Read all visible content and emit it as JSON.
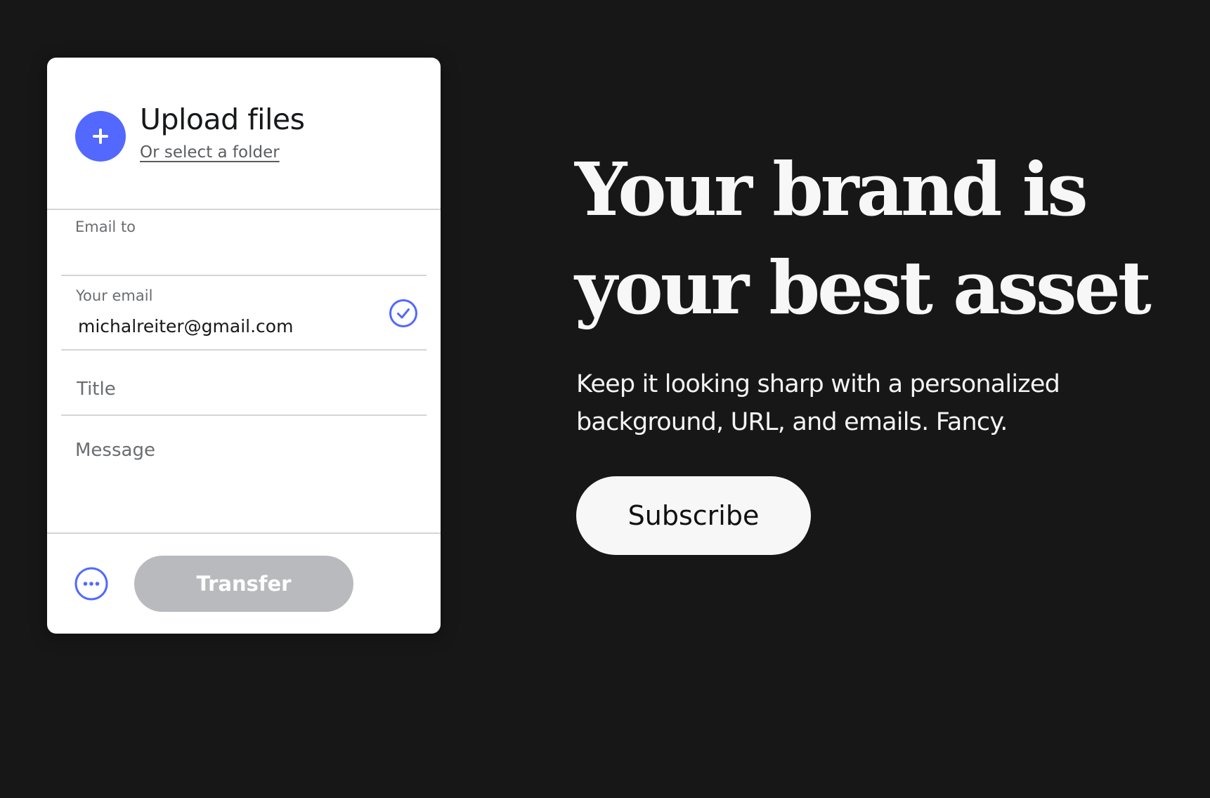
{
  "colors": {
    "page_background": "#171717",
    "accent": "#5268ff",
    "card_background": "#ffffff",
    "transfer_disabled": "#b9babd",
    "subscribe_background": "#f7f7f7"
  },
  "upload_card": {
    "title": "Upload files",
    "folder_link": "Or select a folder",
    "plus_icon": "plus-icon",
    "fields": {
      "email_to": {
        "label": "Email to",
        "value": ""
      },
      "your_email": {
        "label": "Your email",
        "value": "michalreiter@gmail.com",
        "status_icon": "check-circle-icon"
      },
      "title": {
        "placeholder": "Title",
        "value": ""
      },
      "message": {
        "placeholder": "Message",
        "value": ""
      }
    },
    "more_icon": "more-options-icon",
    "transfer_label": "Transfer"
  },
  "promo": {
    "headline_line1": "Your brand is",
    "headline_line2": "your best asset",
    "subtext": "Keep it looking sharp with a personalized background, URL, and emails. Fancy.",
    "subscribe_label": "Subscribe"
  }
}
